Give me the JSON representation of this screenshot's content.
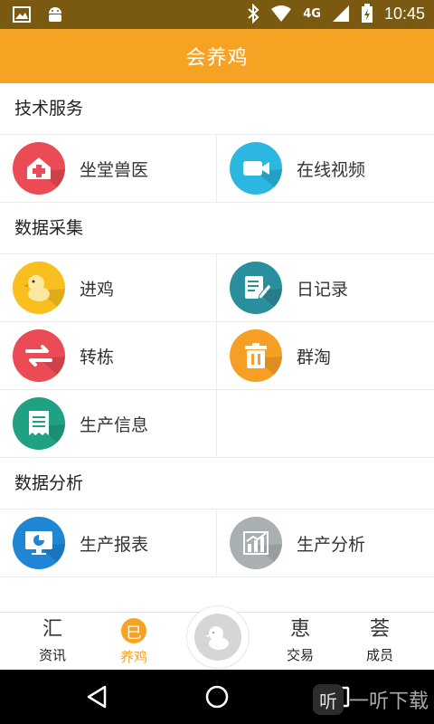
{
  "status_bar": {
    "time": "10:45",
    "network": "4G",
    "icons": [
      "image-icon",
      "android-icon",
      "bluetooth-icon",
      "wifi-icon",
      "signal-icon",
      "battery-icon"
    ]
  },
  "header": {
    "title": "会养鸡"
  },
  "sections": [
    {
      "title": "技术服务",
      "items": [
        {
          "label": "坐堂兽医",
          "icon": "clinic-icon",
          "color": "#ea4b55"
        },
        {
          "label": "在线视频",
          "icon": "video-camera-icon",
          "color": "#2bb7e0"
        }
      ]
    },
    {
      "title": "数据采集",
      "items": [
        {
          "label": "进鸡",
          "icon": "chick-icon",
          "color": "#f8bf1f"
        },
        {
          "label": "日记录",
          "icon": "notebook-edit-icon",
          "color": "#2a8f9c"
        },
        {
          "label": "转栋",
          "icon": "transfer-arrows-icon",
          "color": "#ea4b55"
        },
        {
          "label": "群淘",
          "icon": "trash-icon",
          "color": "#f5a024"
        },
        {
          "label": "生产信息",
          "icon": "receipt-icon",
          "color": "#1fa283"
        }
      ]
    },
    {
      "title": "数据分析",
      "items": [
        {
          "label": "生产报表",
          "icon": "monitor-chart-icon",
          "color": "#1f86d6"
        },
        {
          "label": "生产分析",
          "icon": "bar-chart-icon",
          "color": "#a9b0b2"
        }
      ]
    }
  ],
  "bottom_nav": {
    "items": [
      {
        "label": "资讯",
        "glyph": "汇",
        "active": false
      },
      {
        "label": "养鸡",
        "glyph": "巳",
        "active": true
      },
      {
        "label": "交易",
        "glyph": "恵",
        "active": false
      },
      {
        "label": "成员",
        "glyph": "荟",
        "active": false
      }
    ],
    "accent": "#f6a324"
  },
  "watermark": {
    "text": "一听下载",
    "badge": "听"
  }
}
